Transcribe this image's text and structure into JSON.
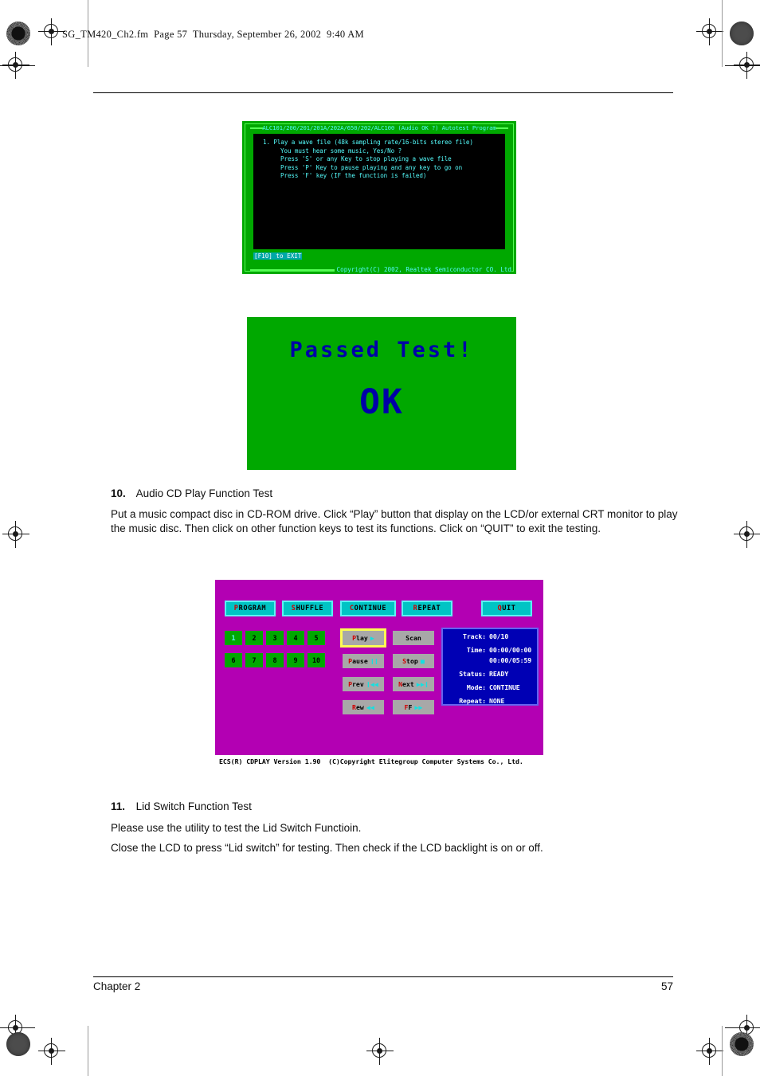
{
  "document_header": "SG_TM420_Ch2.fm  Page 57  Thursday, September 26, 2002  9:40 AM",
  "footer": {
    "chapter": "Chapter 2",
    "page_number": "57"
  },
  "dos_screen": {
    "title": "ALC101/200/201/201A/202A/650/202/ALC100 (Audio OK ?) Autotest Program",
    "lines": [
      "1. Play a wave file (48k sampling rate/16-bits stereo file)",
      "You must hear some music, Yes/No ?",
      "Press 'S' or any Key to stop playing a wave file",
      "Press 'P' Key to pause playing and any key to go on",
      "Press 'F' key (IF the function is failed)"
    ],
    "exit_hint": "[F10] to EXIT",
    "copyright": "Copyright(C) 2002, Realtek Semiconductor CO. Ltd",
    "colors": {
      "background": "#00a800",
      "terminal": "#000000",
      "text": "#54fcfc",
      "frame": "#54fc54"
    }
  },
  "passed_screen": {
    "headline": "Passed Test!",
    "result": "OK",
    "colors": {
      "background": "#00a800",
      "text": "#0000a8"
    }
  },
  "steps": [
    {
      "number": "10.",
      "title": "Audio CD Play Function Test",
      "body": "Put a music compact disc in CD-ROM drive. Click “Play” button that display on the LCD/or external CRT monitor to play the music disc. Then click on other function keys to test its functions. Click on “QUIT” to exit the testing."
    },
    {
      "number": "11.",
      "title": "Lid Switch Function Test",
      "body1": "Please use the utility to test the Lid Switch Functioin.",
      "body2": "Close the LCD to press “Lid switch” for testing. Then check if the LCD backlight is on or off."
    }
  ],
  "cd_player": {
    "mode_buttons": [
      {
        "hot": "P",
        "rest": "ROGRAM",
        "label": "PROGRAM"
      },
      {
        "hot": "S",
        "rest": "HUFFLE",
        "label": "SHUFFLE"
      },
      {
        "hot": "C",
        "rest": "ONTINUE",
        "label": "CONTINUE"
      },
      {
        "hot": "R",
        "rest": "EPEAT",
        "label": "REPEAT"
      },
      {
        "hot": "Q",
        "rest": "UIT",
        "label": "QUIT"
      }
    ],
    "track_buttons": [
      "1",
      "2",
      "3",
      "4",
      "5",
      "6",
      "7",
      "8",
      "9",
      "10"
    ],
    "active_track": "1",
    "control_buttons": [
      {
        "hot": "P",
        "rest": "lay",
        "label": "Play",
        "glyph": "▶",
        "focused": true
      },
      {
        "hot": "",
        "rest": "Scan",
        "label": "Scan",
        "glyph": ""
      },
      {
        "hot": "P",
        "rest": "ause",
        "label": "Pause",
        "glyph": "❙❙"
      },
      {
        "hot": "S",
        "rest": "top",
        "label": "Stop",
        "glyph": "■"
      },
      {
        "hot": "P",
        "rest": "rev",
        "label": "Prev",
        "glyph": "❙◀◀"
      },
      {
        "hot": "N",
        "rest": "ext",
        "label": "Next",
        "glyph": "▶▶❙"
      },
      {
        "hot": "R",
        "rest": "ew",
        "label": "Rew",
        "glyph": "◀◀"
      },
      {
        "hot": "F",
        "rest": "F",
        "label": "FF",
        "glyph": "▶▶"
      }
    ],
    "status": {
      "track_label": "Track:",
      "track_value": "00/10",
      "time_label": "Time:",
      "time_value": "00:00/00:00",
      "time_value2": "00:00/05:59",
      "status_label": "Status:",
      "status_value": "READY",
      "mode_label": "Mode:",
      "mode_value": "CONTINUE",
      "repeat_label": "Repeat:",
      "repeat_value": "NONE"
    },
    "statusbar": "ECS(R) CDPLAY Version 1.90  (C)Copyright Elitegroup Computer Systems Co., Ltd.",
    "colors": {
      "background": "#b300b3",
      "mode_button": "#00c4c4",
      "track_button": "#00a800",
      "control_button": "#a8a8a8",
      "focus_ring": "#fcfc54",
      "panel": "#0000b4"
    }
  }
}
